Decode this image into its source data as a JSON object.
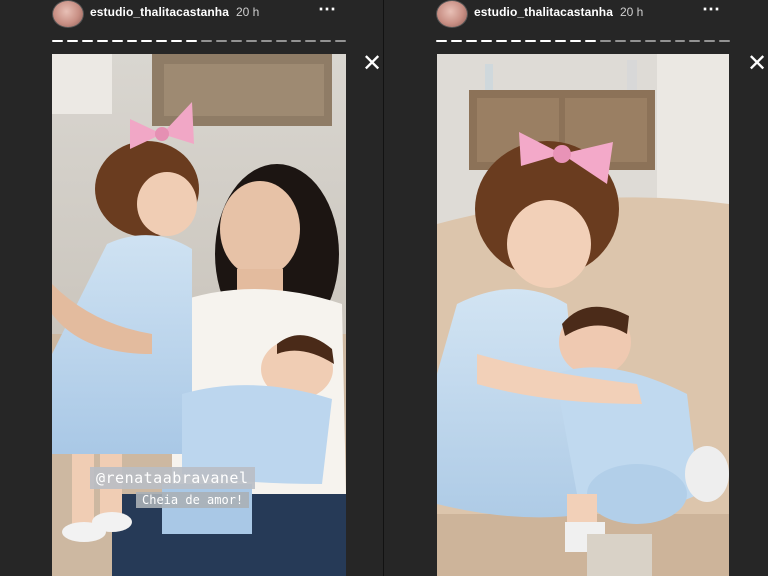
{
  "stories": [
    {
      "username": "estudio_thalitacastanha",
      "time": "20 h",
      "more_icon": "⋯",
      "close_icon": "✕",
      "mention": "@renataabravanel",
      "caption": "Cheia de amor!"
    },
    {
      "username": "estudio_thalitacastanha",
      "time": "20 h",
      "more_icon": "⋯",
      "close_icon": "✕"
    }
  ]
}
